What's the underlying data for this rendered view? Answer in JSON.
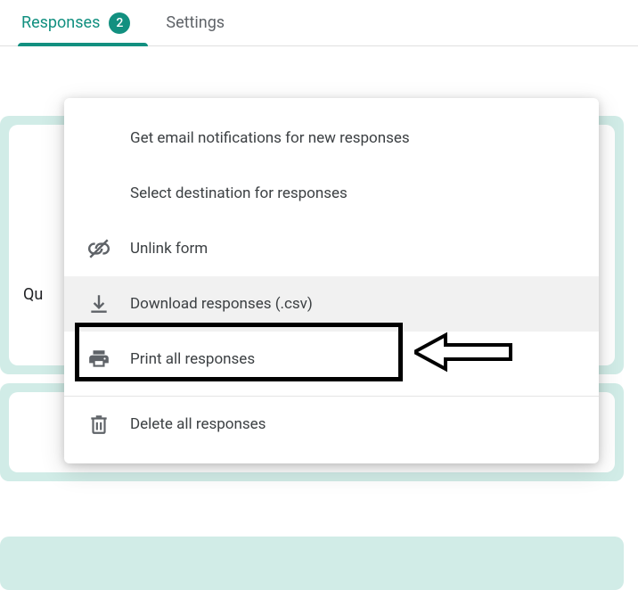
{
  "tabs": {
    "responses": {
      "label": "Responses",
      "badge": "2"
    },
    "settings": {
      "label": "Settings"
    }
  },
  "background": {
    "question_label_fragment": "Qu"
  },
  "menu": {
    "email_notifications": "Get email notifications for new responses",
    "select_destination": "Select destination for responses",
    "unlink_form": "Unlink form",
    "download_csv": "Download responses (.csv)",
    "print_all": "Print all responses",
    "delete_all": "Delete all responses"
  }
}
